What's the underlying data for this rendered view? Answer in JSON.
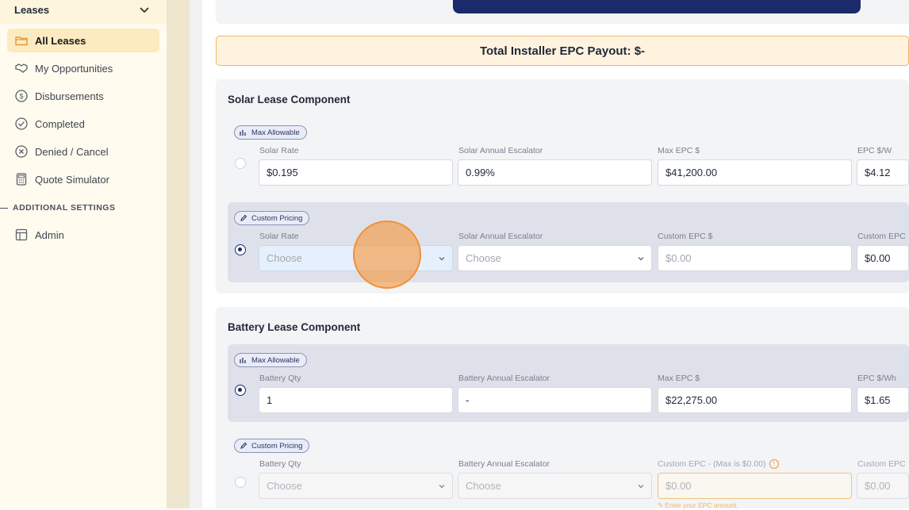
{
  "sidebar": {
    "section_title": "Leases",
    "items": [
      {
        "label": "All Leases",
        "icon": "folder-icon",
        "active": true
      },
      {
        "label": "My Opportunities",
        "icon": "handshake-icon"
      },
      {
        "label": "Disbursements",
        "icon": "dollar-circle-icon"
      },
      {
        "label": "Completed",
        "icon": "check-circle-icon"
      },
      {
        "label": "Denied / Cancel",
        "icon": "x-circle-icon"
      },
      {
        "label": "Quote Simulator",
        "icon": "calculator-icon"
      }
    ],
    "additional_settings_label": "ADDITIONAL SETTINGS",
    "admin_item": {
      "label": "Admin",
      "icon": "table-layout-icon"
    }
  },
  "payout": {
    "label": "Total Installer EPC Payout: $-"
  },
  "solar": {
    "title": "Solar Lease Component",
    "max_allowable": {
      "tag": "Max Allowable",
      "fields": [
        {
          "label": "Solar Rate",
          "value": "$0.195"
        },
        {
          "label": "Solar Annual Escalator",
          "value": "0.99%"
        },
        {
          "label": "Max EPC $",
          "value": "$41,200.00"
        },
        {
          "label": "EPC $/W",
          "value": "$4.12"
        }
      ]
    },
    "custom_pricing": {
      "tag": "Custom Pricing",
      "fields": [
        {
          "label": "Solar Rate",
          "placeholder": "Choose"
        },
        {
          "label": "Solar Annual Escalator",
          "placeholder": "Choose"
        },
        {
          "label": "Custom EPC $",
          "placeholder": "$0.00"
        },
        {
          "label": "Custom EPC",
          "value": "$0.00"
        }
      ]
    }
  },
  "battery": {
    "title": "Battery Lease Component",
    "max_allowable": {
      "tag": "Max Allowable",
      "fields": [
        {
          "label": "Battery Qty",
          "value": "1"
        },
        {
          "label": "Battery Annual Escalator",
          "value": "-"
        },
        {
          "label": "Max EPC $",
          "value": "$22,275.00"
        },
        {
          "label": "EPC $/Wh",
          "value": "$1.65"
        }
      ]
    },
    "custom_pricing": {
      "tag": "Custom Pricing",
      "fields": [
        {
          "label": "Battery Qty",
          "placeholder": "Choose"
        },
        {
          "label": "Battery Annual Escalator",
          "placeholder": "Choose"
        },
        {
          "label": "Custom EPC - (Max is $0.00)",
          "placeholder": "$0.00",
          "hint": "Enter your EPC amount."
        },
        {
          "label": "Custom EPC",
          "value": "$0.00"
        }
      ]
    }
  },
  "colors": {
    "accent": "#1b2a6b",
    "sidebar_bg": "#fffbee",
    "highlight": "#fcebc0",
    "warning": "#f0b46a",
    "cursor": "#f0913a"
  }
}
